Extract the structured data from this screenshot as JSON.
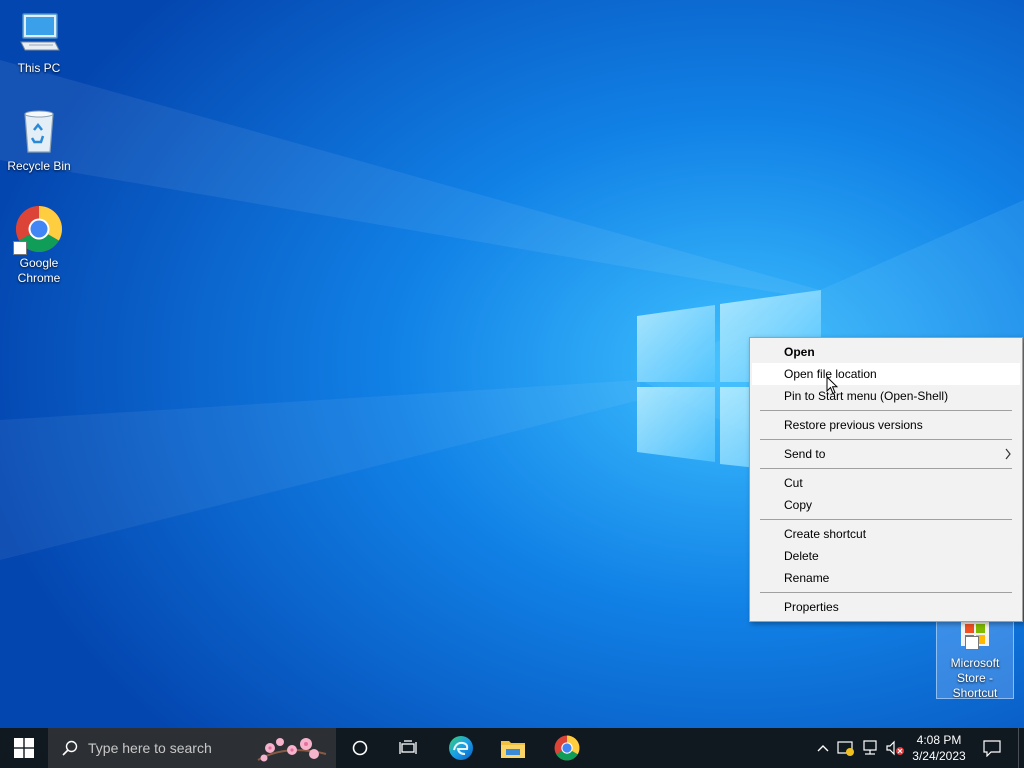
{
  "desktop": {
    "icons": [
      {
        "label": "This PC",
        "icon": "this-pc-icon"
      },
      {
        "label": "Recycle Bin",
        "icon": "recycle-bin-icon"
      },
      {
        "label": "Google Chrome",
        "icon": "chrome-icon"
      },
      {
        "label": "Microsoft Store - Shortcut",
        "icon": "microsoft-store-icon"
      }
    ]
  },
  "context_menu": {
    "items": [
      {
        "label": "Open"
      },
      {
        "label": "Open file location"
      },
      {
        "label": "Pin to Start menu (Open-Shell)"
      },
      {
        "label": "Restore previous versions"
      },
      {
        "label": "Send to"
      },
      {
        "label": "Cut"
      },
      {
        "label": "Copy"
      },
      {
        "label": "Create shortcut"
      },
      {
        "label": "Delete"
      },
      {
        "label": "Rename"
      },
      {
        "label": "Properties"
      }
    ]
  },
  "taskbar": {
    "search_placeholder": "Type here to search",
    "clock_time": "4:08 PM",
    "clock_date": "3/24/2023",
    "apps": [
      "edge-icon",
      "file-explorer-icon",
      "chrome-icon"
    ]
  },
  "colors": {
    "wallpaper": "#0a6fd6",
    "taskbar": "#101820",
    "menu_bg": "#f2f2f2",
    "menu_hover": "#ffffff"
  }
}
